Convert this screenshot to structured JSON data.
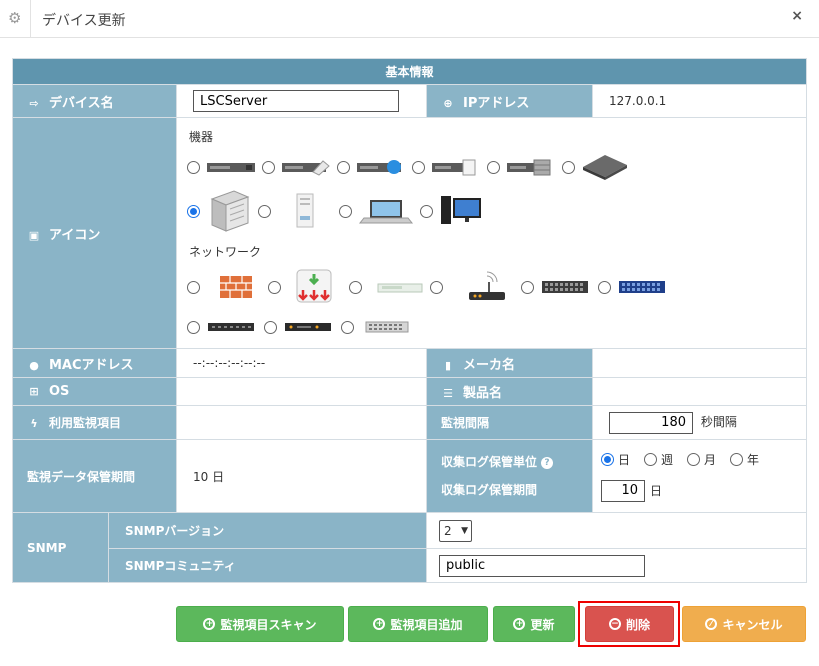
{
  "window": {
    "title": "デバイス更新",
    "icon": "gear-icon",
    "close": "×"
  },
  "section_header": "基本情報",
  "fields": {
    "device_name_label": "デバイス名",
    "device_name_value": "LSCServer",
    "ip_label": "IPアドレス",
    "ip_value": "127.0.0.1",
    "icon_label": "アイコン",
    "mac_label": "MACアドレス",
    "mac_value": "--:--:--:--:--:--",
    "maker_label": "メーカ名",
    "maker_value": "",
    "os_label": "OS",
    "os_value": "",
    "product_label": "製品名",
    "product_value": "",
    "monitor_items_label": "利用監視項目",
    "monitor_items_value": "",
    "interval_label": "監視間隔",
    "interval_value": "180",
    "interval_unit": "秒間隔",
    "retention_label": "監視データ保管期間",
    "retention_value": "10 日",
    "log_unit_label": "収集ログ保管単位",
    "log_period_label": "収集ログ保管期間",
    "log_units": [
      "日",
      "週",
      "月",
      "年"
    ],
    "log_unit_selected": "日",
    "log_period_value": "10",
    "log_period_unit": "日",
    "snmp_label": "SNMP",
    "snmp_version_label": "SNMPバージョン",
    "snmp_version_value": "2",
    "snmp_community_label": "SNMPコミュニティ",
    "snmp_community_value": "public"
  },
  "icon_groups": {
    "device_label": "機器",
    "network_label": "ネットワーク",
    "selected": "tower-server-icon"
  },
  "buttons": {
    "scan": "監視項目スキャン",
    "add": "監視項目追加",
    "update": "更新",
    "delete": "削除",
    "cancel": "キャンセル"
  },
  "colors": {
    "header": "#5f95ae",
    "label": "#8ab4c7",
    "green": "#5cb85c",
    "red": "#d9534f",
    "orange": "#f0ad4e",
    "highlight": "#ee0000"
  }
}
